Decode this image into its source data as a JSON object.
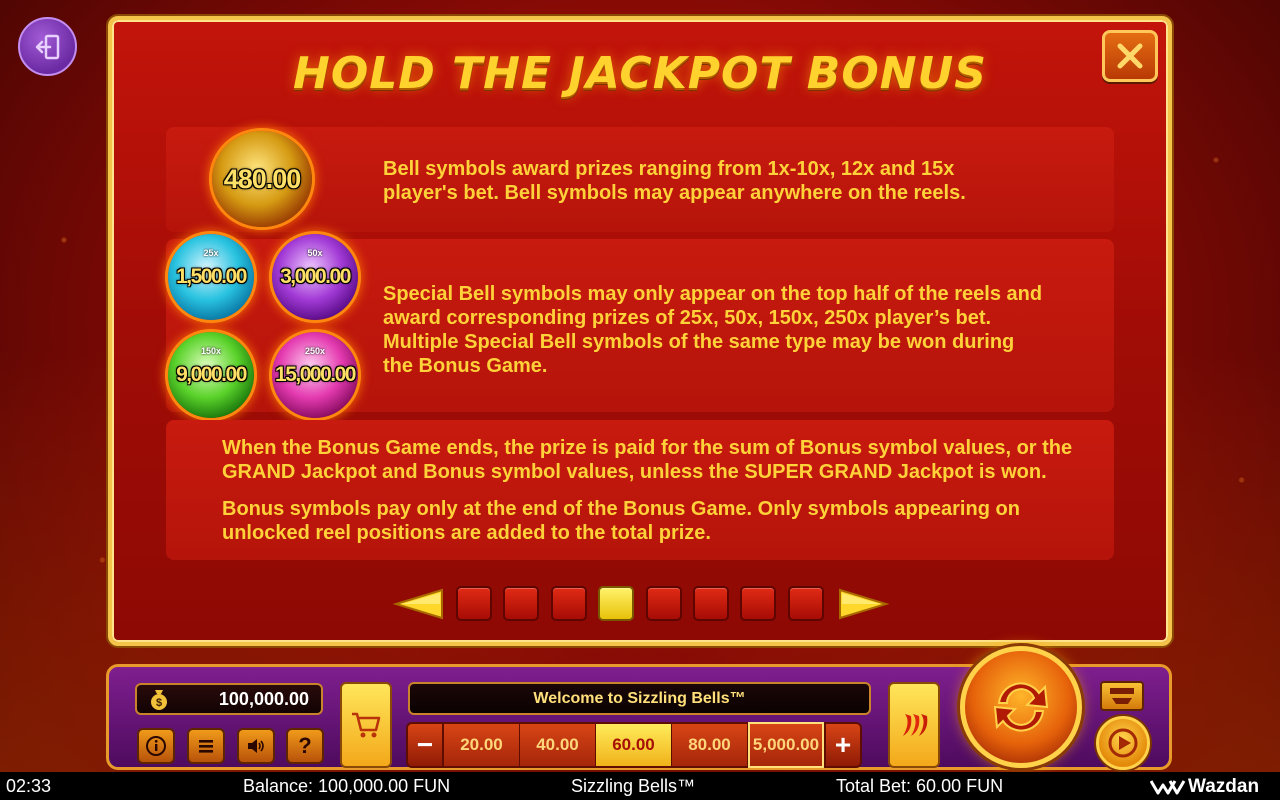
{
  "title": "HOLD THE JACKPOT BONUS",
  "rows": {
    "row1_text_line1": "Bell symbols award prizes ranging from 1x-10x, 12x and 15x",
    "row1_text_line2": "player's bet. Bell symbols may appear anywhere on the reels.",
    "row2_line1": "Special Bell symbols may only appear on the top half of the reels and",
    "row2_line2": "award corresponding prizes of 25x, 50x, 150x, 250x player’s bet.",
    "row2_line3": "Multiple Special Bell symbols of the same type may be won during",
    "row2_line4": "the Bonus Game.",
    "row3_p1_line1": "When the Bonus Game ends, the prize is paid for the sum of Bonus symbol values, or the",
    "row3_p1_line2": "GRAND Jackpot and Bonus symbol values, unless the SUPER GRAND Jackpot is won.",
    "row3_p2_line1": "Bonus symbols pay only at the end of the Bonus Game. Only symbols appearing on",
    "row3_p2_line2": "unlocked reel positions are added to the total prize."
  },
  "bells": {
    "gold": "480.00",
    "cyan": {
      "value": "1,500.00",
      "mult": "25x"
    },
    "purple": {
      "value": "3,000.00",
      "mult": "50x"
    },
    "green": {
      "value": "9,000.00",
      "mult": "150x"
    },
    "pink": {
      "value": "15,000.00",
      "mult": "250x"
    }
  },
  "pager": {
    "pages": 8,
    "active_page": 4
  },
  "controls": {
    "balance": "100,000.00",
    "message": "Welcome to Sizzling Bells™",
    "bets": [
      "20.00",
      "40.00",
      "60.00",
      "80.00",
      "5,000.00"
    ],
    "selected_bet": "60.00",
    "minus": "−",
    "plus": "+",
    "help": "?"
  },
  "status": {
    "time": "02:33",
    "balance": "Balance: 100,000.00 FUN",
    "game": "Sizzling Bells™",
    "total_bet": "Total Bet: 60.00 FUN",
    "brand": "Wazdan"
  },
  "colors": {
    "accent_gold": "#ffd22e",
    "panel_red": "#b5140a",
    "text_yellow": "#ffd23a",
    "purple_bar": "#6b1f7f"
  },
  "icons": [
    "exit-icon",
    "close-icon",
    "money-bag-icon",
    "info-icon",
    "menu-icon",
    "sound-icon",
    "cart-icon",
    "chili-icon",
    "spin-icon",
    "turbo-icon",
    "autoplay-icon",
    "arrow-left-icon",
    "arrow-right-icon",
    "wazdan-logo-icon"
  ]
}
